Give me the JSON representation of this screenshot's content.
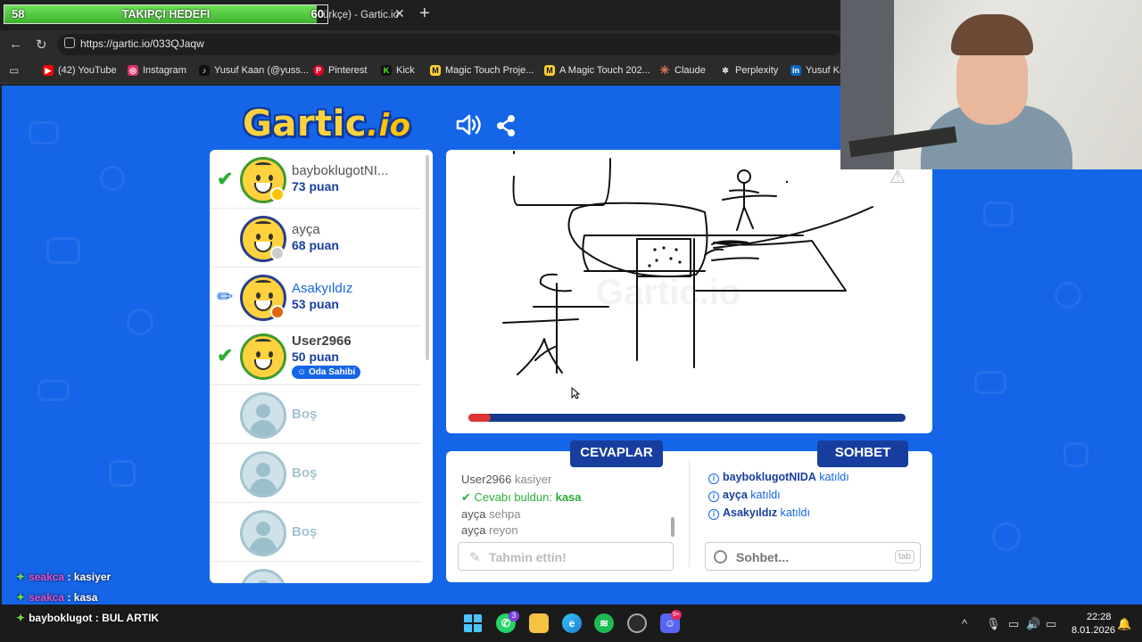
{
  "follower_goal": {
    "current": "58",
    "goal": "60",
    "label": "TAKIPÇI HEDEFI",
    "progress": 0.967
  },
  "browser": {
    "tab_title": "ürkçe) - Gartic.io",
    "url": "https://gartic.io/033QJaqw",
    "bookmarks": [
      {
        "label": "(42) YouTube",
        "icon": "youtube-icon",
        "color": "#ff0000"
      },
      {
        "label": "Instagram",
        "icon": "instagram-icon",
        "color": "#e1306c"
      },
      {
        "label": "Yusuf Kaan (@yuss...",
        "icon": "tiktok-icon",
        "color": "#111111"
      },
      {
        "label": "Pinterest",
        "icon": "pinterest-icon",
        "color": "#e60023"
      },
      {
        "label": "Kick",
        "icon": "kick-icon",
        "color": "#53fc18"
      },
      {
        "label": "Magic Touch Proje...",
        "icon": "miro-icon",
        "color": "#ffd02f"
      },
      {
        "label": "A Magic Touch 202...",
        "icon": "miro-icon",
        "color": "#ffd02f"
      },
      {
        "label": "Claude",
        "icon": "claude-icon",
        "color": "#d97757"
      },
      {
        "label": "Perplexity",
        "icon": "perplexity-icon",
        "color": "#20808d"
      },
      {
        "label": "Yusuf Ka",
        "icon": "linkedin-icon",
        "color": "#0a66c2"
      }
    ]
  },
  "game": {
    "logo": "Gartic",
    "logo_suffix": ".io",
    "players": [
      {
        "name": "bayboklugotNI...",
        "score": "73 puan",
        "status": "guessed",
        "dot_color": "#ffc400"
      },
      {
        "name": "ayça",
        "score": "68 puan",
        "status": "none",
        "dot_color": "#cccccc"
      },
      {
        "name": "Asakyıldız",
        "score": "53 puan",
        "status": "drawing",
        "dot_color": "#e0650b"
      },
      {
        "name": "User2966",
        "score": "50 puan",
        "status": "guessed",
        "dot_color": "",
        "badge": "Oda Sahibi"
      }
    ],
    "empty_slots": [
      "Boş",
      "Boş",
      "Boş"
    ],
    "watermark": "Gartic.io",
    "timer_progress": 0.05,
    "answers_tab": "CEVAPLAR",
    "chat_tab": "SOHBET",
    "answers": [
      {
        "user": "User2966",
        "text": "kasiyer"
      },
      {
        "found_label": "Cevabı buldun:",
        "word": "kasa"
      },
      {
        "user": "ayça",
        "text": "sehpa"
      },
      {
        "user": "ayça",
        "text": "reyon"
      }
    ],
    "guess_placeholder": "Tahmin ettin!",
    "system_messages": [
      {
        "user": "bayboklugotNIDA",
        "text": "katıldı"
      },
      {
        "user": "ayça",
        "text": "katıldı"
      },
      {
        "user": "Asakyıldız",
        "text": "katıldı"
      }
    ],
    "chat_placeholder": "Sohbet...",
    "chat_key_hint": "tab"
  },
  "stream_chat": [
    {
      "user": "seakca",
      "text": ": kasiyer"
    },
    {
      "user": "seakca",
      "text": ": kasa"
    },
    {
      "user": "bayboklugot",
      "text": ": BUL ARTIK"
    }
  ],
  "taskbar": {
    "time": "22:28",
    "date": "8.01.2026",
    "whatsapp_badge": "3",
    "discord_badge": "9+"
  }
}
